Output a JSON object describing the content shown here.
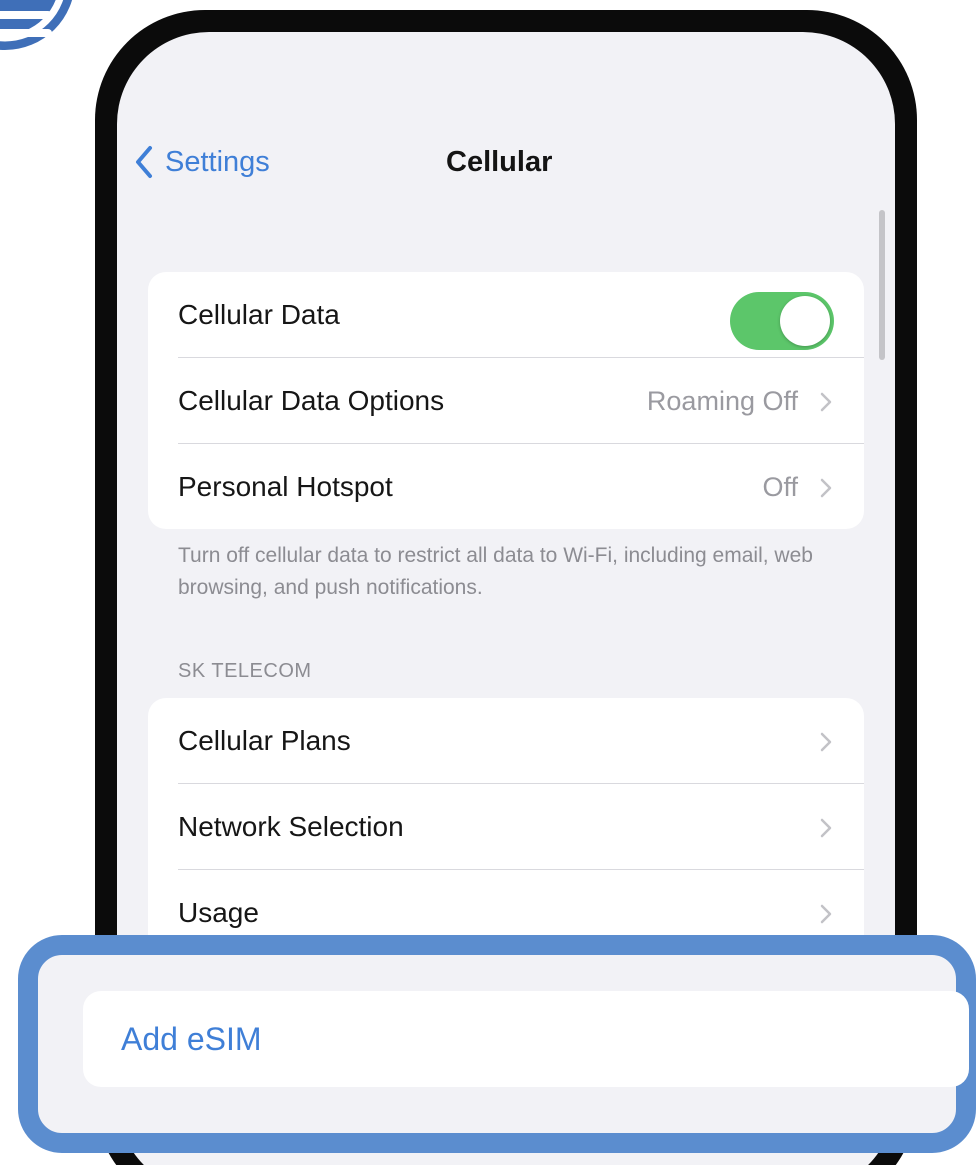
{
  "nav": {
    "back_label": "Settings",
    "title": "Cellular"
  },
  "data_group": {
    "cellular_data_label": "Cellular Data",
    "cellular_data_enabled": true,
    "options_label": "Cellular Data Options",
    "options_value": "Roaming Off",
    "hotspot_label": "Personal Hotspot",
    "hotspot_value": "Off"
  },
  "footnote": "Turn off cellular data to restrict all data to Wi-Fi, including email, web browsing, and push notifications.",
  "carrier_section": {
    "header": "SK TELECOM",
    "items": [
      {
        "label": "Cellular Plans"
      },
      {
        "label": "Network Selection"
      },
      {
        "label": "Usage"
      }
    ]
  },
  "highlight": {
    "add_esim_label": "Add eSIM"
  },
  "colors": {
    "accent_blue": "#3f7fd7",
    "toggle_green": "#5cc66a",
    "highlight_border": "#5b8dcf",
    "grouped_background": "#f2f2f6",
    "phone_frame": "#0b0b0b"
  },
  "icons": {
    "back": "chevron-left-icon",
    "disclosure": "chevron-right-icon",
    "corner_badge": "logo-icon"
  }
}
